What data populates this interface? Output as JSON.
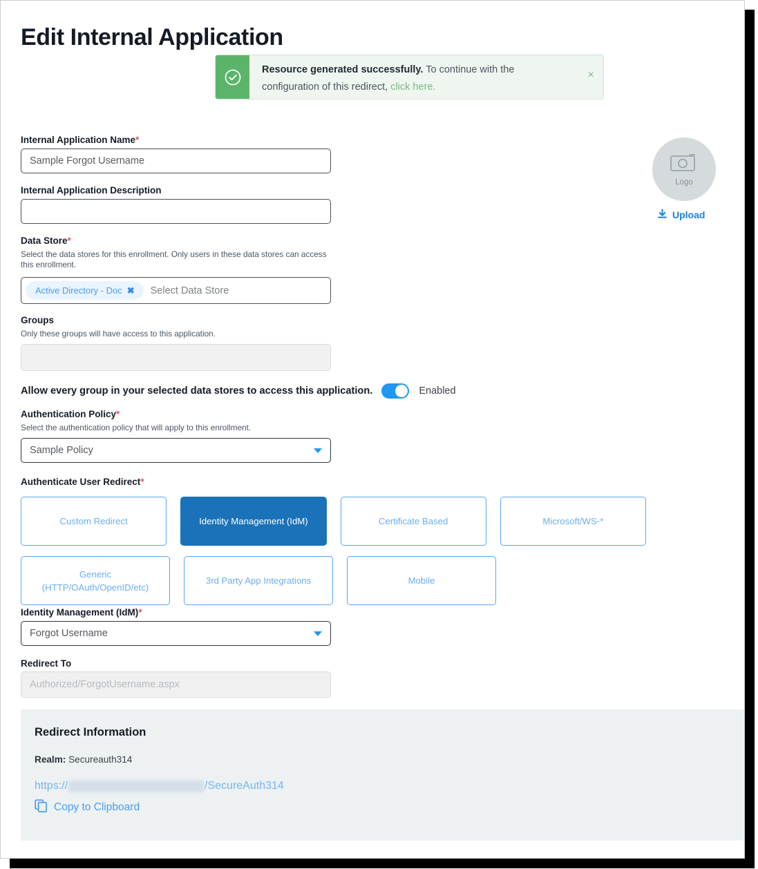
{
  "page": {
    "title": "Edit Internal Application"
  },
  "alert": {
    "icon": "check-circle-icon",
    "bold_text": "Resource generated successfully.",
    "rest_text": " To continue with the configuration of this redirect, ",
    "link_text": "click here.",
    "close_label": "×",
    "bar_color": "#5cb46b",
    "bg_color": "#eef6ef"
  },
  "form": {
    "app_name": {
      "label": "Internal Application Name",
      "required": "*",
      "value": "Sample Forgot Username"
    },
    "app_description": {
      "label": "Internal Application Description",
      "value": "",
      "placeholder": ""
    },
    "data_store": {
      "label": "Data Store",
      "required": "*",
      "help": "Select the data stores for this enrollment. Only users in these data stores can access this enrollment.",
      "chips": [
        {
          "label": "Active Directory - Doc",
          "remove": "✖"
        }
      ],
      "placeholder": "Select Data Store"
    },
    "groups": {
      "label": "Groups",
      "help": "Only these groups will have access to this application.",
      "value": "",
      "disabled": true
    },
    "allow_all_groups": {
      "label": "Allow every group in your selected data stores to access this application.",
      "state": "Enabled",
      "on": true,
      "accent": "#2196f3"
    },
    "auth_policy": {
      "label": "Authentication Policy",
      "required": "*",
      "help": "Select the authentication policy that will apply to this enrollment.",
      "value": "Sample Policy"
    },
    "authenticate_user_redirect": {
      "label": "Authenticate User Redirect",
      "required": "*",
      "tiles": [
        {
          "label": "Custom Redirect",
          "selected": false
        },
        {
          "label": "Identity Management (IdM)",
          "selected": true
        },
        {
          "label": "Certificate Based",
          "selected": false
        },
        {
          "label": "Microsoft/WS-*",
          "selected": false
        },
        {
          "label": "Generic (HTTP/OAuth/OpenID/etc)",
          "selected": false
        },
        {
          "label": "3rd Party App Integrations",
          "selected": false
        },
        {
          "label": "Mobile",
          "selected": false
        }
      ],
      "selected_color": "#1a72b8",
      "unselected_text_color": "#69aef2"
    },
    "idm": {
      "label": "Identity Management (IdM)",
      "required": "*",
      "value": "Forgot Username"
    },
    "redirect_to": {
      "label": "Redirect To",
      "value": "Authorized/ForgotUsername.aspx",
      "disabled": true
    }
  },
  "logo": {
    "icon": "camera-icon",
    "caption": "Logo",
    "upload_icon": "download-arrow-icon",
    "upload_label": "Upload",
    "link_color": "#1b7fe0"
  },
  "redirect_information": {
    "title": "Redirect Information",
    "realm_label": "Realm:",
    "realm_value": "Secureauth314",
    "url_prefix": "https://",
    "url_redacted": true,
    "url_suffix": "/SecureAuth314",
    "copy_icon": "copy-icon",
    "copy_label": "Copy to Clipboard",
    "bg_color": "#edf1f2"
  }
}
